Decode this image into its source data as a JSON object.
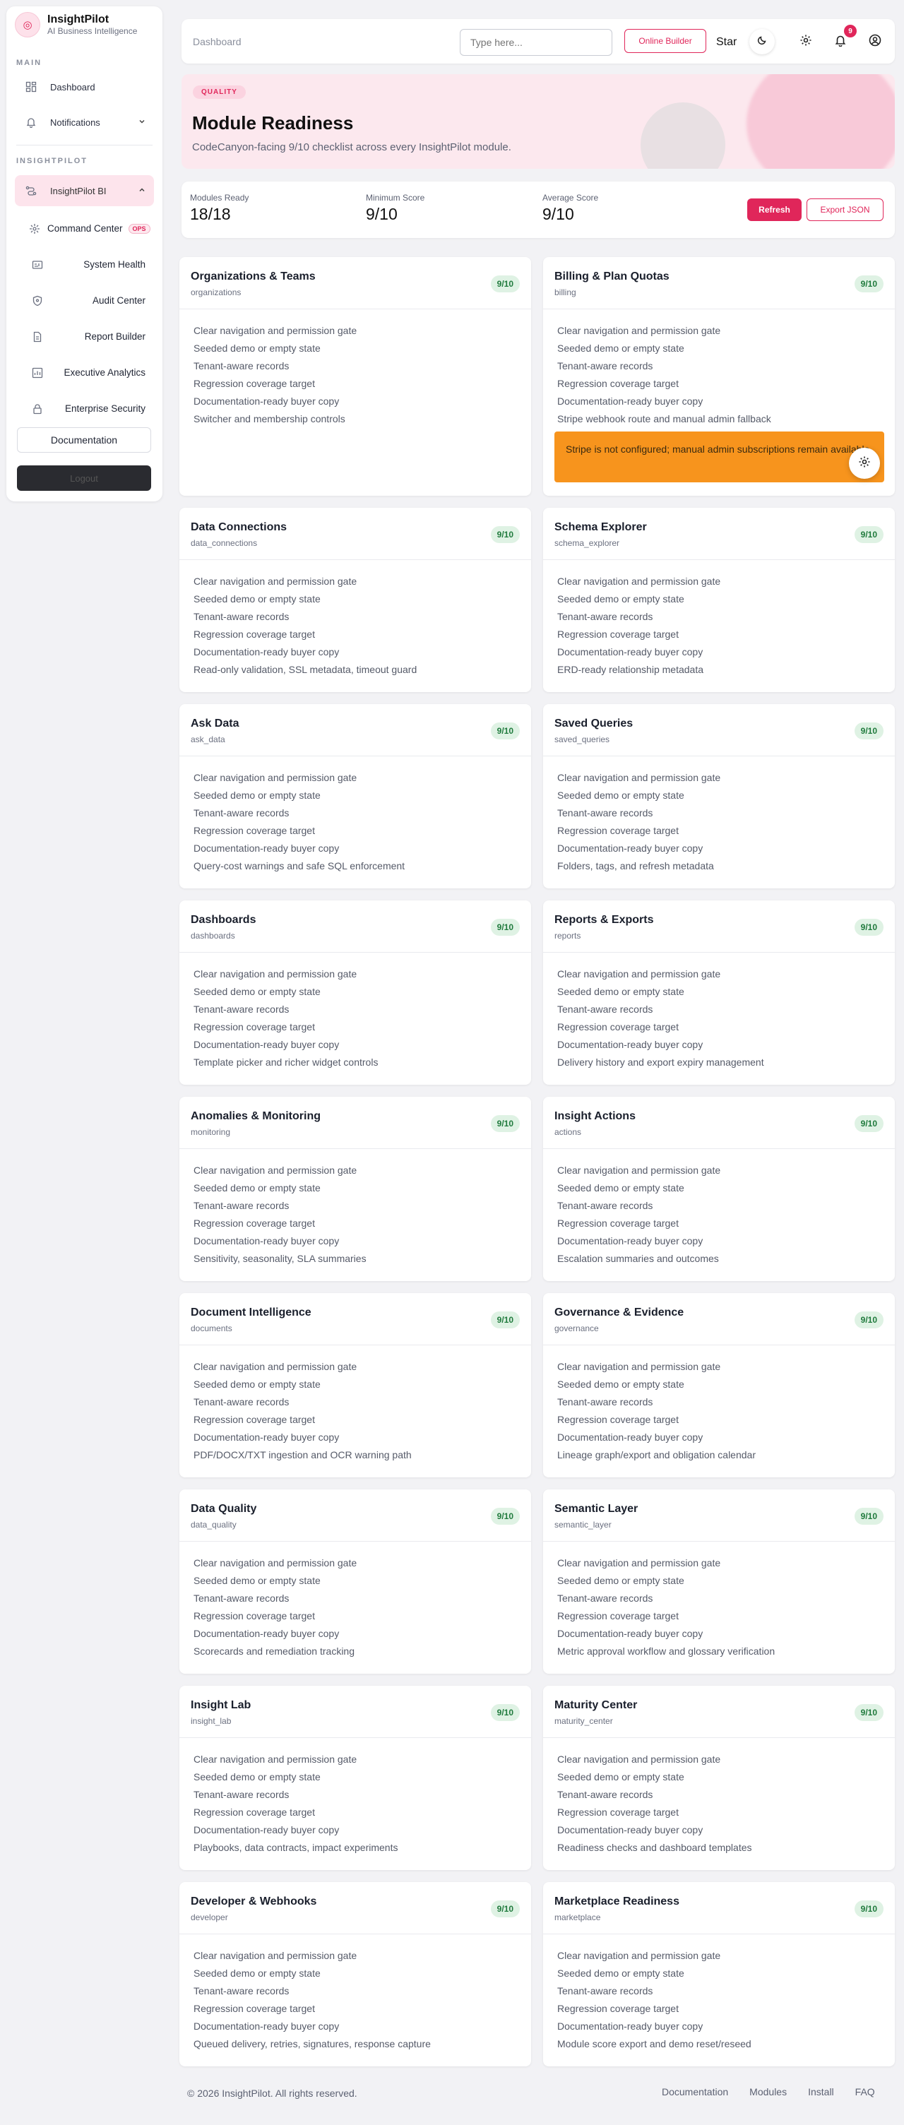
{
  "brand": {
    "name": "InsightPilot",
    "tagline": "AI Business Intelligence"
  },
  "sidebar": {
    "main_section": "MAIN",
    "dashboard": "Dashboard",
    "notifications": "Notifications",
    "app_section": "INSIGHTPILOT",
    "insightpilot_bi": "InsightPilot BI",
    "sub_items": [
      {
        "label": "Command Center",
        "badge": "OPS"
      },
      {
        "label": "System Health"
      },
      {
        "label": "Audit Center"
      },
      {
        "label": "Report Builder"
      },
      {
        "label": "Executive Analytics"
      },
      {
        "label": "Enterprise Security"
      }
    ],
    "documentation": "Documentation",
    "logout": "Logout"
  },
  "topbar": {
    "breadcrumb": "Dashboard",
    "search_placeholder": "Type here...",
    "online_builder": "Online Builder",
    "star": "Star",
    "notification_count": "9"
  },
  "hero": {
    "badge": "QUALITY",
    "title": "Module Readiness",
    "subtitle": "CodeCanyon-facing 9/10 checklist across every InsightPilot module."
  },
  "stats": {
    "modules_ready_label": "Modules Ready",
    "modules_ready": "18/18",
    "minimum_score_label": "Minimum Score",
    "minimum_score": "9/10",
    "average_score_label": "Average Score",
    "average_score": "9/10",
    "refresh": "Refresh",
    "export": "Export JSON"
  },
  "common_checks": [
    "Clear navigation and permission gate",
    "Seeded demo or empty state",
    "Tenant-aware records",
    "Regression coverage target",
    "Documentation-ready buyer copy"
  ],
  "modules": [
    {
      "title": "Organizations & Teams",
      "slug": "organizations",
      "score": "9/10",
      "extra": "Switcher and membership controls"
    },
    {
      "title": "Billing & Plan Quotas",
      "slug": "billing",
      "score": "9/10",
      "extra": "Stripe webhook route and manual admin fallback",
      "warning": "Stripe is not configured; manual admin subscriptions remain available."
    },
    {
      "title": "Data Connections",
      "slug": "data_connections",
      "score": "9/10",
      "extra": "Read-only validation, SSL metadata, timeout guard"
    },
    {
      "title": "Schema Explorer",
      "slug": "schema_explorer",
      "score": "9/10",
      "extra": "ERD-ready relationship metadata"
    },
    {
      "title": "Ask Data",
      "slug": "ask_data",
      "score": "9/10",
      "extra": "Query-cost warnings and safe SQL enforcement"
    },
    {
      "title": "Saved Queries",
      "slug": "saved_queries",
      "score": "9/10",
      "extra": "Folders, tags, and refresh metadata"
    },
    {
      "title": "Dashboards",
      "slug": "dashboards",
      "score": "9/10",
      "extra": "Template picker and richer widget controls"
    },
    {
      "title": "Reports & Exports",
      "slug": "reports",
      "score": "9/10",
      "extra": "Delivery history and export expiry management"
    },
    {
      "title": "Anomalies & Monitoring",
      "slug": "monitoring",
      "score": "9/10",
      "extra": "Sensitivity, seasonality, SLA summaries"
    },
    {
      "title": "Insight Actions",
      "slug": "actions",
      "score": "9/10",
      "extra": "Escalation summaries and outcomes"
    },
    {
      "title": "Document Intelligence",
      "slug": "documents",
      "score": "9/10",
      "extra": "PDF/DOCX/TXT ingestion and OCR warning path"
    },
    {
      "title": "Governance & Evidence",
      "slug": "governance",
      "score": "9/10",
      "extra": "Lineage graph/export and obligation calendar"
    },
    {
      "title": "Data Quality",
      "slug": "data_quality",
      "score": "9/10",
      "extra": "Scorecards and remediation tracking"
    },
    {
      "title": "Semantic Layer",
      "slug": "semantic_layer",
      "score": "9/10",
      "extra": "Metric approval workflow and glossary verification"
    },
    {
      "title": "Insight Lab",
      "slug": "insight_lab",
      "score": "9/10",
      "extra": "Playbooks, data contracts, impact experiments"
    },
    {
      "title": "Maturity Center",
      "slug": "maturity_center",
      "score": "9/10",
      "extra": "Readiness checks and dashboard templates"
    },
    {
      "title": "Developer & Webhooks",
      "slug": "developer",
      "score": "9/10",
      "extra": "Queued delivery, retries, signatures, response capture"
    },
    {
      "title": "Marketplace Readiness",
      "slug": "marketplace",
      "score": "9/10",
      "extra": "Module score export and demo reset/reseed"
    }
  ],
  "footer": {
    "copyright": "© 2026 InsightPilot. All rights reserved.",
    "links": [
      "Documentation",
      "Modules",
      "Install",
      "FAQ"
    ]
  }
}
